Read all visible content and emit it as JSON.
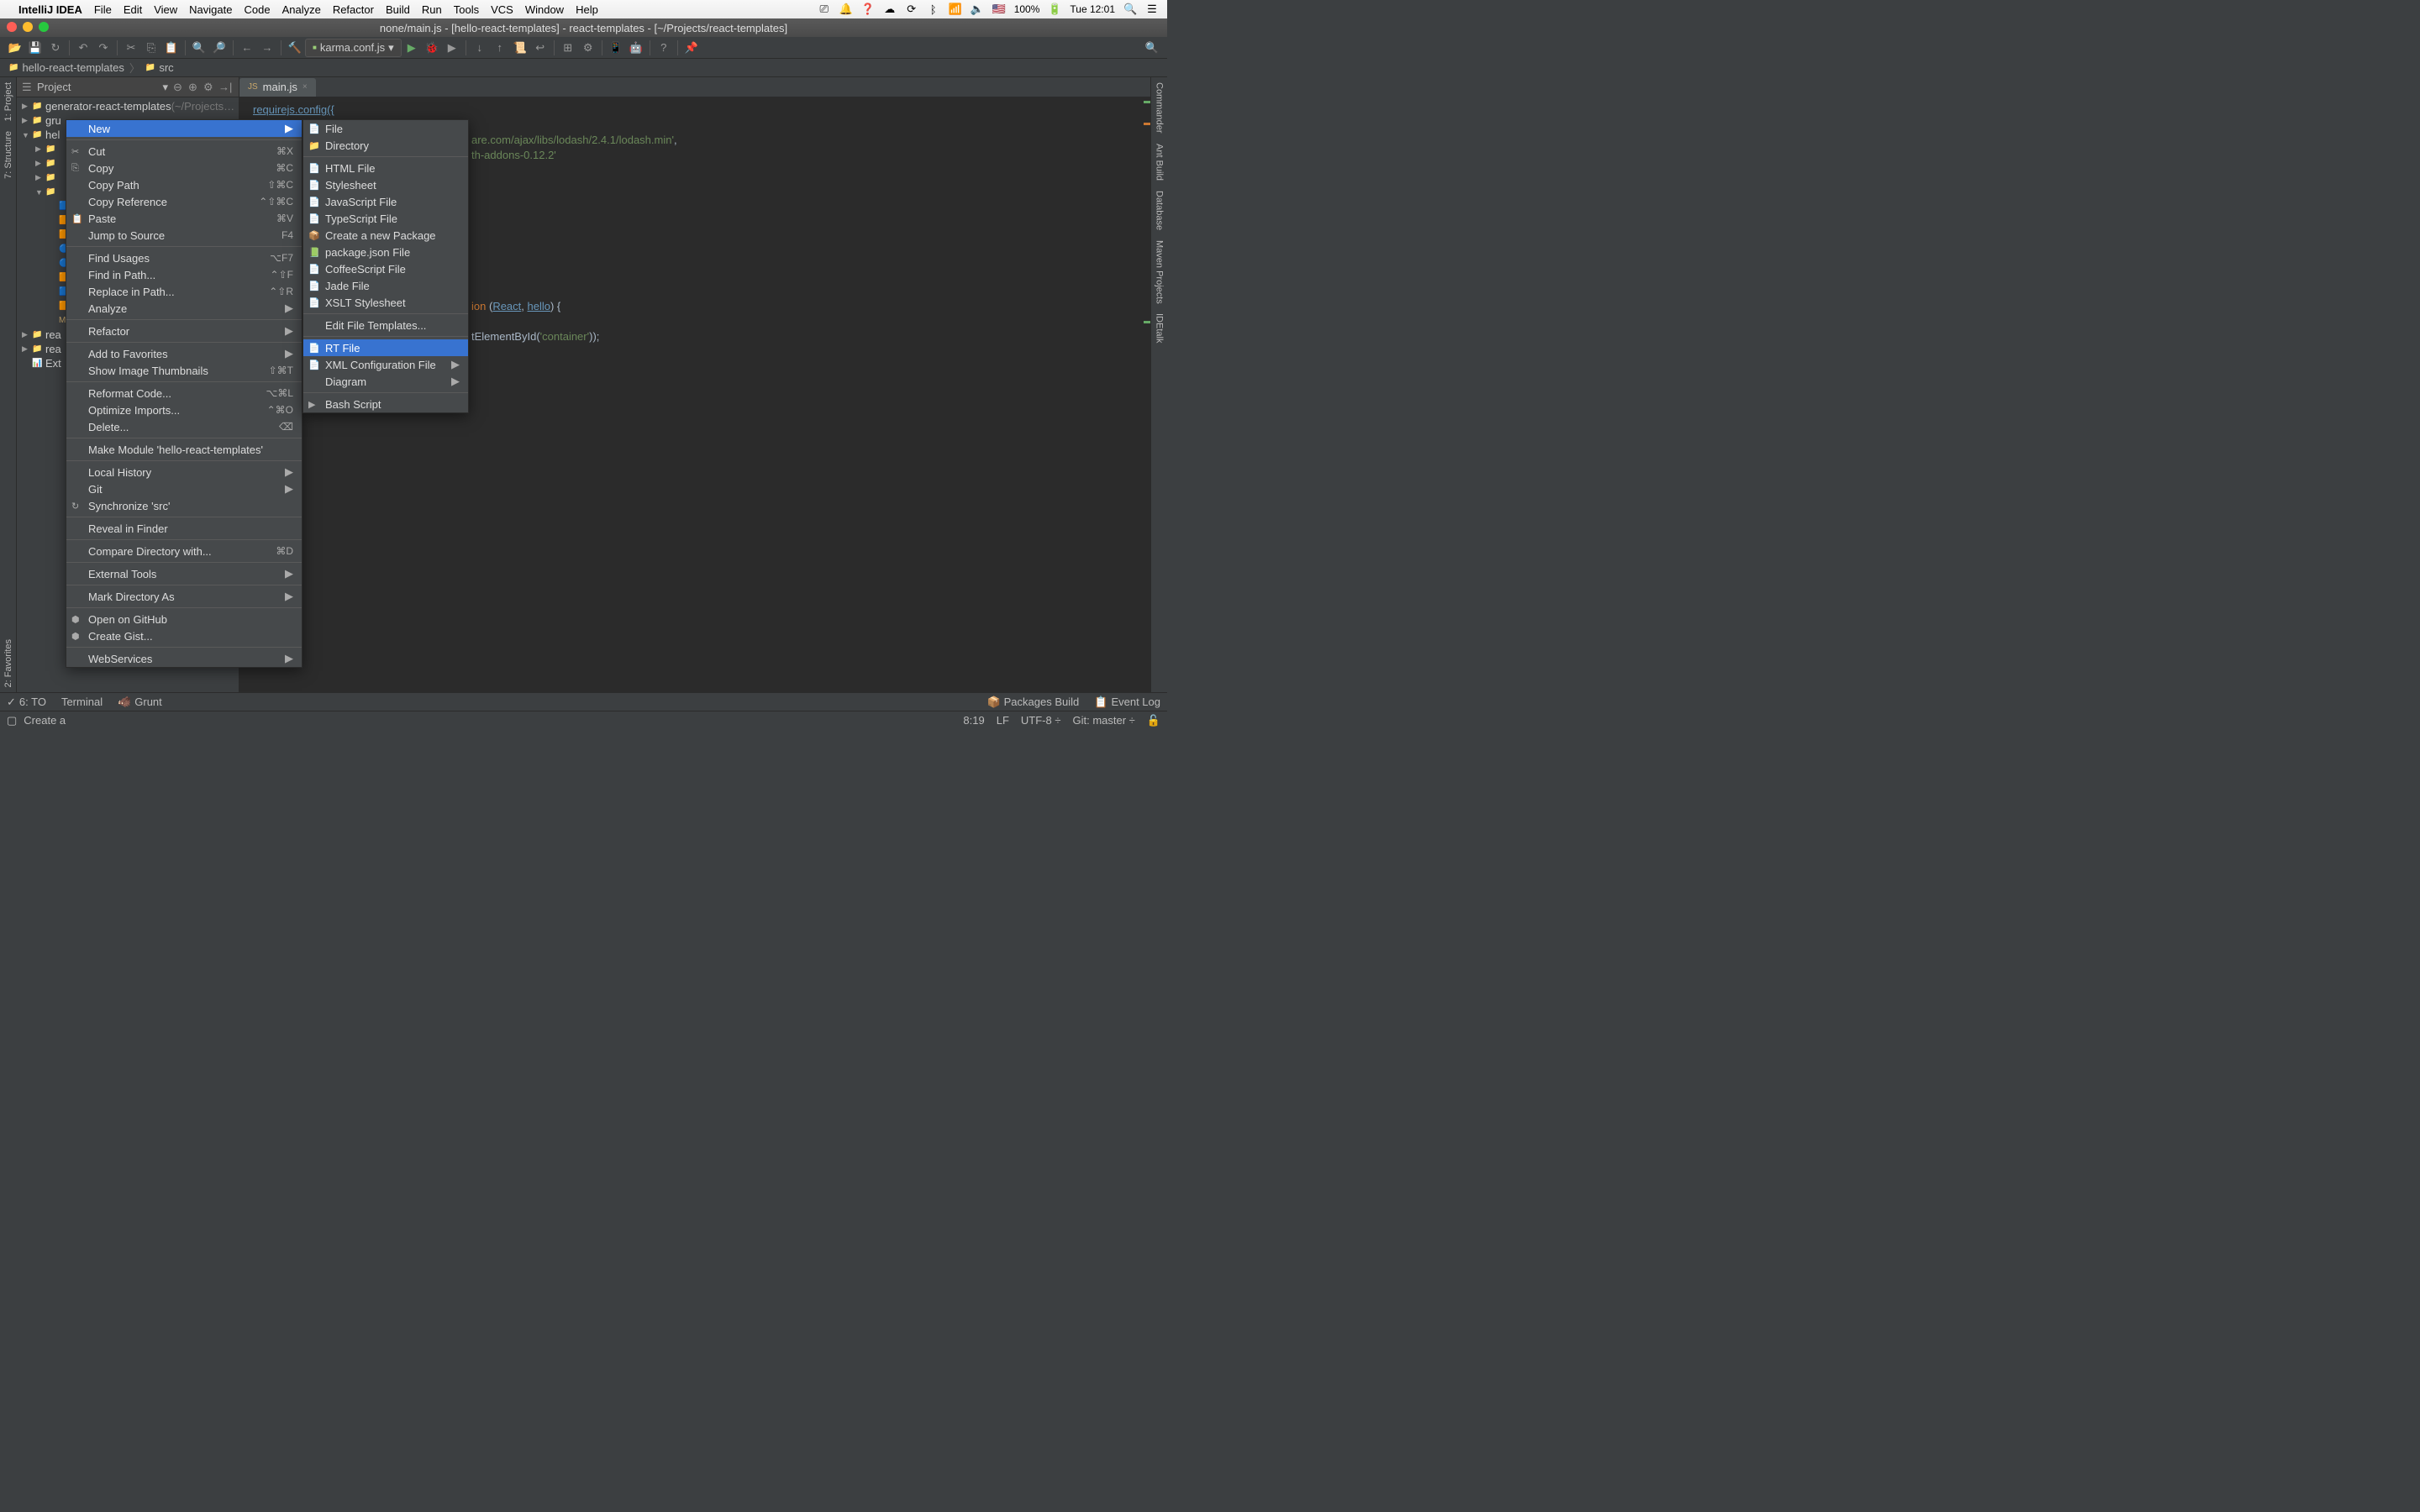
{
  "menubar": {
    "app": "IntelliJ IDEA",
    "items": [
      "File",
      "Edit",
      "View",
      "Navigate",
      "Code",
      "Analyze",
      "Refactor",
      "Build",
      "Run",
      "Tools",
      "VCS",
      "Window",
      "Help"
    ],
    "battery": "100%",
    "clock": "Tue 12:01"
  },
  "titlebar": "none/main.js - [hello-react-templates] - react-templates - [~/Projects/react-templates]",
  "toolbar": {
    "run_config": "karma.conf.js"
  },
  "breadcrumb": {
    "project": "hello-react-templates",
    "folder": "src"
  },
  "project_panel": {
    "header": "Project",
    "tree": [
      {
        "indent": 0,
        "arrow": "▶",
        "icon": "📁",
        "label": "generator-react-templates",
        "suffix": "(~/Projects…"
      },
      {
        "indent": 0,
        "arrow": "▶",
        "icon": "📁",
        "label": "gru"
      },
      {
        "indent": 0,
        "arrow": "▼",
        "icon": "📁",
        "label": "hel"
      },
      {
        "indent": 1,
        "arrow": "▶",
        "icon": "📁",
        "label": ""
      },
      {
        "indent": 1,
        "arrow": "▶",
        "icon": "📁",
        "label": ""
      },
      {
        "indent": 1,
        "arrow": "▶",
        "icon": "📁",
        "label": ""
      },
      {
        "indent": 1,
        "arrow": "▼",
        "icon": "📁",
        "label": ""
      },
      {
        "indent": 2,
        "arrow": "",
        "icon": "🟦",
        "label": ""
      },
      {
        "indent": 2,
        "arrow": "",
        "icon": "🟧",
        "label": ""
      },
      {
        "indent": 2,
        "arrow": "",
        "icon": "🟧",
        "label": ""
      },
      {
        "indent": 2,
        "arrow": "",
        "icon": "🔵",
        "label": ""
      },
      {
        "indent": 2,
        "arrow": "",
        "icon": "🔵",
        "label": ""
      },
      {
        "indent": 2,
        "arrow": "",
        "icon": "🟧",
        "label": ""
      },
      {
        "indent": 2,
        "arrow": "",
        "icon": "🟦",
        "label": ""
      },
      {
        "indent": 2,
        "arrow": "",
        "icon": "🟧",
        "label": ""
      },
      {
        "indent": 2,
        "arrow": "",
        "icon": "M",
        "label": ""
      },
      {
        "indent": 0,
        "arrow": "▶",
        "icon": "📁",
        "label": "rea"
      },
      {
        "indent": 0,
        "arrow": "▶",
        "icon": "📁",
        "label": "rea"
      },
      {
        "indent": 0,
        "arrow": "",
        "icon": "📊",
        "label": "Ext"
      }
    ]
  },
  "tab": {
    "name": "main.js"
  },
  "editor_lines": {
    "l1": "requirejs.config({",
    "l3a": "are.com/ajax/libs/lodash/2.4.1/lodash.min'",
    "l3b": ",",
    "l4": "th-addons-0.12.2'",
    "l9a": "ion",
    "l9b": " (",
    "l9c": "React",
    "l9d": ", ",
    "l9e": "hello",
    "l9f": ") {",
    "l10a": "tElementById(",
    "l10b": "'container'",
    "l10c": "));"
  },
  "context_menu": {
    "items": [
      {
        "icon": "",
        "label": "New",
        "short": "",
        "arrow": "▶",
        "sel": true
      },
      {
        "sep": true
      },
      {
        "icon": "✂",
        "label": "Cut",
        "short": "⌘X"
      },
      {
        "icon": "⎘",
        "label": "Copy",
        "short": "⌘C"
      },
      {
        "icon": "",
        "label": "Copy Path",
        "short": "⇧⌘C"
      },
      {
        "icon": "",
        "label": "Copy Reference",
        "short": "⌃⇧⌘C"
      },
      {
        "icon": "📋",
        "label": "Paste",
        "short": "⌘V"
      },
      {
        "icon": "",
        "label": "Jump to Source",
        "short": "F4"
      },
      {
        "sep": true
      },
      {
        "icon": "",
        "label": "Find Usages",
        "short": "⌥F7"
      },
      {
        "icon": "",
        "label": "Find in Path...",
        "short": "⌃⇧F"
      },
      {
        "icon": "",
        "label": "Replace in Path...",
        "short": "⌃⇧R"
      },
      {
        "icon": "",
        "label": "Analyze",
        "arrow": "▶"
      },
      {
        "sep": true
      },
      {
        "icon": "",
        "label": "Refactor",
        "arrow": "▶"
      },
      {
        "sep": true
      },
      {
        "icon": "",
        "label": "Add to Favorites",
        "arrow": "▶"
      },
      {
        "icon": "",
        "label": "Show Image Thumbnails",
        "short": "⇧⌘T"
      },
      {
        "sep": true
      },
      {
        "icon": "",
        "label": "Reformat Code...",
        "short": "⌥⌘L"
      },
      {
        "icon": "",
        "label": "Optimize Imports...",
        "short": "⌃⌘O"
      },
      {
        "icon": "",
        "label": "Delete...",
        "short": "⌫"
      },
      {
        "sep": true
      },
      {
        "icon": "",
        "label": "Make Module 'hello-react-templates'"
      },
      {
        "sep": true
      },
      {
        "icon": "",
        "label": "Local History",
        "arrow": "▶"
      },
      {
        "icon": "",
        "label": "Git",
        "arrow": "▶"
      },
      {
        "icon": "↻",
        "label": "Synchronize 'src'"
      },
      {
        "sep": true
      },
      {
        "icon": "",
        "label": "Reveal in Finder"
      },
      {
        "sep": true
      },
      {
        "icon": "",
        "label": "Compare Directory with...",
        "short": "⌘D"
      },
      {
        "sep": true
      },
      {
        "icon": "",
        "label": "External Tools",
        "arrow": "▶"
      },
      {
        "sep": true
      },
      {
        "icon": "",
        "label": "Mark Directory As",
        "arrow": "▶"
      },
      {
        "sep": true
      },
      {
        "icon": "⬢",
        "label": "Open on GitHub"
      },
      {
        "icon": "⬢",
        "label": "Create Gist..."
      },
      {
        "sep": true
      },
      {
        "icon": "",
        "label": "WebServices",
        "arrow": "▶"
      }
    ],
    "submenu": [
      {
        "icon": "📄",
        "label": "File"
      },
      {
        "icon": "📁",
        "label": "Directory"
      },
      {
        "sep": true
      },
      {
        "icon": "📄",
        "label": "HTML File"
      },
      {
        "icon": "📄",
        "label": "Stylesheet"
      },
      {
        "icon": "📄",
        "label": "JavaScript File"
      },
      {
        "icon": "📄",
        "label": "TypeScript File"
      },
      {
        "icon": "📦",
        "label": "Create a new Package"
      },
      {
        "icon": "📗",
        "label": "package.json File"
      },
      {
        "icon": "📄",
        "label": "CoffeeScript File"
      },
      {
        "icon": "📄",
        "label": "Jade File"
      },
      {
        "icon": "📄",
        "label": "XSLT Stylesheet"
      },
      {
        "sep": true
      },
      {
        "icon": "",
        "label": "Edit File Templates..."
      },
      {
        "sep": true
      },
      {
        "icon": "📄",
        "label": "RT File",
        "sel": true
      },
      {
        "icon": "📄",
        "label": "XML Configuration File",
        "arrow": "▶"
      },
      {
        "icon": "",
        "label": "Diagram",
        "arrow": "▶"
      },
      {
        "sep": true
      },
      {
        "icon": "▶",
        "label": "Bash Script"
      }
    ]
  },
  "left_gutter": [
    "1: Project",
    "7: Structure"
  ],
  "left_gutter_bottom": "2: Favorites",
  "right_gutter": [
    "Commander",
    "Ant Build",
    "Database",
    "Maven Projects",
    "IDEtalk"
  ],
  "bottom_toolwindows": {
    "left": [
      "6: TO",
      "Terminal",
      "Grunt"
    ],
    "right": [
      "Packages Build",
      "Event Log"
    ]
  },
  "statusbar": {
    "hint": "Create a",
    "pos": "8:19",
    "lf": "LF",
    "enc": "UTF-8",
    "git": "Git: master"
  }
}
